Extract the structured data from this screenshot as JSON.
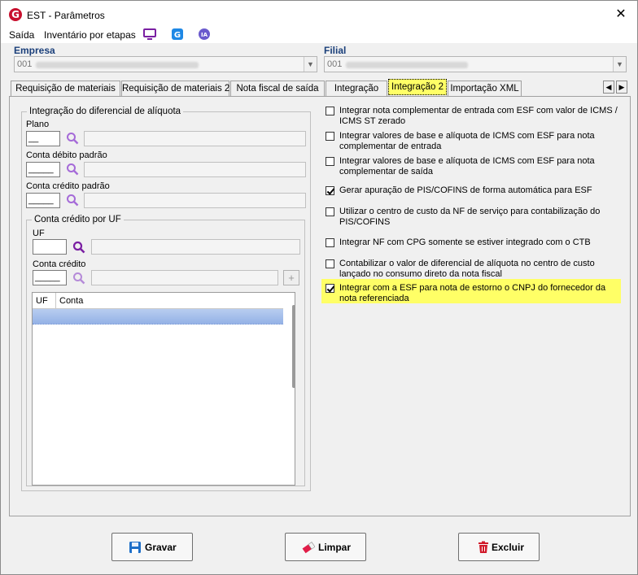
{
  "window": {
    "title": "EST - Parâmetros",
    "close": "✕"
  },
  "menu": {
    "saida": "Saída",
    "inventario": "Inventário por etapas"
  },
  "toolbar_icons": [
    "monitor-icon",
    "app-g-icon",
    "ia-icon"
  ],
  "ia_label": "IA",
  "empresa": {
    "label": "Empresa",
    "value": "001"
  },
  "filial": {
    "label": "Filial",
    "value": "001"
  },
  "tabs": [
    "Requisição de materiais",
    "Requisição de materiais 2",
    "Nota fiscal de saída",
    "Integração",
    "Integração 2",
    "Importação XML"
  ],
  "active_tab": "Integração 2",
  "left": {
    "group_title": "Integração do diferencial de alíquota",
    "plano_label": "Plano",
    "plano_value": "__",
    "debito_label": "Conta débito padrão",
    "debito_value": "_____",
    "credito_label": "Conta crédito padrão",
    "credito_value": "_____",
    "uf_group_title": "Conta crédito por UF",
    "uf_label": "UF",
    "uf_value": "",
    "conta_credito_label": "Conta crédito",
    "conta_credito_value": "_____",
    "grid_headers": [
      "UF",
      "Conta"
    ]
  },
  "options": [
    {
      "label": "Integrar nota complementar de entrada com ESF com valor de ICMS / ICMS ST zerado",
      "checked": false
    },
    {
      "label": "Integrar valores de base e alíquota de ICMS com ESF para nota complementar de entrada",
      "checked": false
    },
    {
      "label": "Integrar valores de base e alíquota de ICMS com ESF para nota complementar de saída",
      "checked": false
    },
    {
      "label": "Gerar apuração de PIS/COFINS de forma automática para ESF",
      "checked": true
    },
    {
      "label": "Utilizar o centro de custo da NF de serviço para contabilização do PIS/COFINS",
      "checked": false
    },
    {
      "label": "Integrar NF com CPG somente se estiver integrado com o CTB",
      "checked": false
    },
    {
      "label": "Contabilizar o valor de diferencial de alíquota no centro de custo lançado no consumo direto da nota fiscal",
      "checked": false
    },
    {
      "label": "Integrar com a ESF para nota de estorno o CNPJ do fornecedor da nota referenciada",
      "checked": true
    }
  ],
  "buttons": {
    "gravar": "Gravar",
    "limpar": "Limpar",
    "excluir": "Excluir"
  },
  "colors": {
    "highlight": "#ffff66",
    "label_blue": "#1a3f7a",
    "search_purple": "#8a2be2",
    "brand_red": "#c8102e"
  }
}
